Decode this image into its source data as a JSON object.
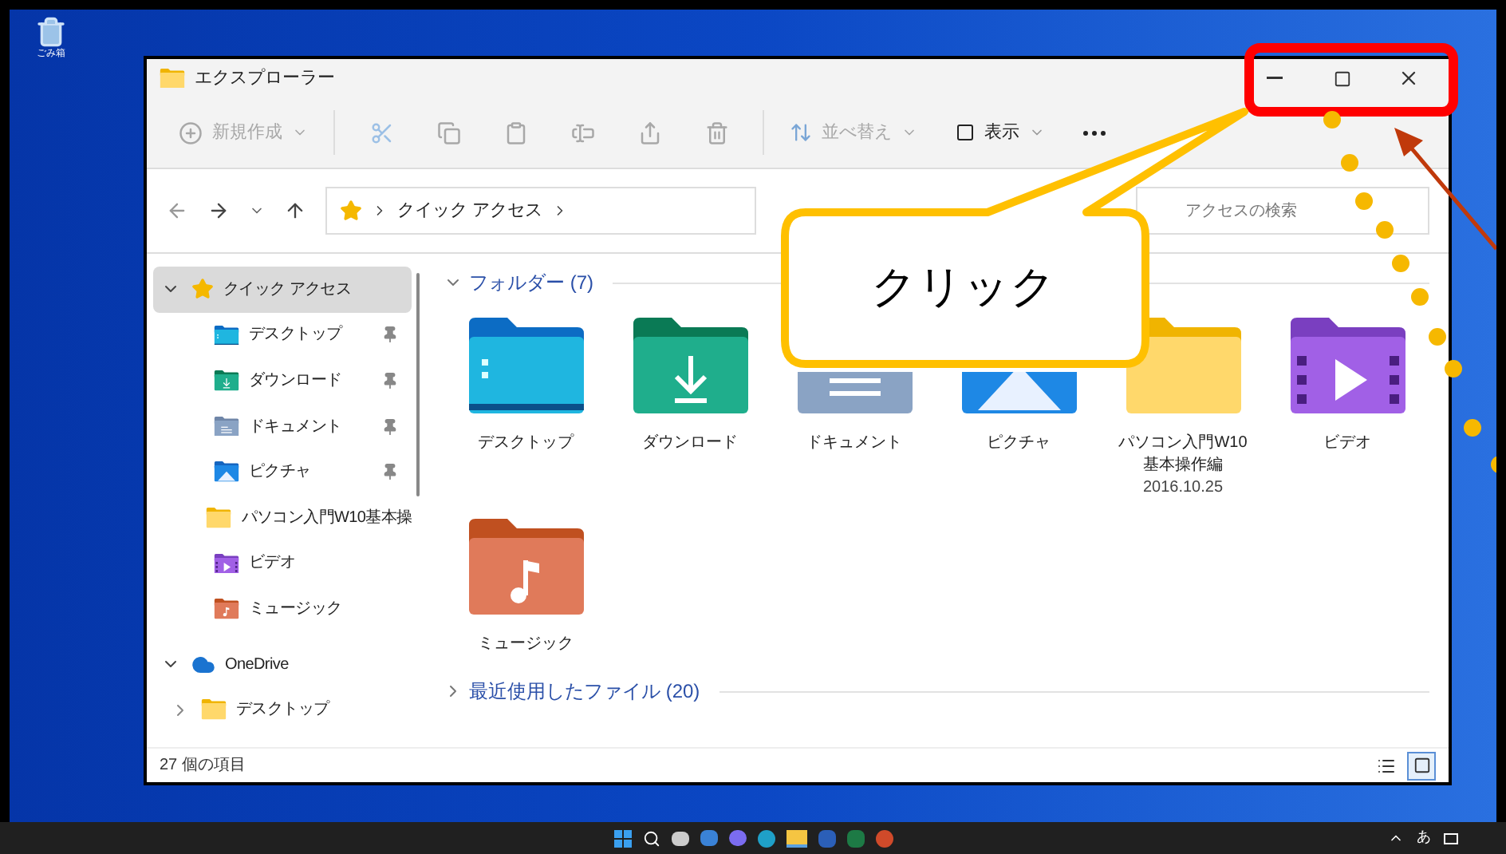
{
  "desktop": {
    "icons": [
      {
        "label": "ごみ箱"
      }
    ]
  },
  "window": {
    "title": "エクスプローラー"
  },
  "toolbar": [
    {
      "kind": "new",
      "label": "新規作成",
      "disabled": true
    },
    {
      "kind": "cut",
      "disabled": true
    },
    {
      "kind": "copy",
      "disabled": true
    },
    {
      "kind": "paste",
      "disabled": true
    },
    {
      "kind": "rename",
      "disabled": true
    },
    {
      "kind": "share",
      "disabled": true
    },
    {
      "kind": "delete",
      "disabled": true
    },
    {
      "kind": "sort",
      "label": "並べ替え",
      "disabled": true
    },
    {
      "kind": "view",
      "label": "表示",
      "disabled": false
    },
    {
      "kind": "more",
      "disabled": false
    }
  ],
  "address_bar": {
    "path": [
      "クイック アクセス"
    ]
  },
  "search": {
    "placeholder": "アクセスの検索"
  },
  "sidebar": {
    "items": [
      {
        "label": "クイック アクセス",
        "kind": "star",
        "expanded": true,
        "selected": true,
        "children": [
          {
            "label": "デスクトップ",
            "kind": "desktop",
            "pinned": true,
            "selected": false
          },
          {
            "label": "ダウンロード",
            "kind": "download",
            "pinned": true,
            "selected": false
          },
          {
            "label": "ドキュメント",
            "kind": "documents",
            "pinned": true,
            "selected": false
          },
          {
            "label": "ピクチャ",
            "kind": "pictures",
            "pinned": true,
            "selected": false
          },
          {
            "label": "パソコン入門W10基本操",
            "kind": "folder",
            "pinned": false,
            "selected": false
          },
          {
            "label": "ビデオ",
            "kind": "video",
            "pinned": false,
            "selected": false
          },
          {
            "label": "ミュージック",
            "kind": "music",
            "pinned": false,
            "selected": false
          }
        ]
      },
      {
        "label": "OneDrive",
        "kind": "cloud",
        "expanded": true,
        "selected": false,
        "children": [
          {
            "label": "デスクトップ",
            "kind": "folder",
            "expanded": false,
            "selected": false
          }
        ]
      }
    ]
  },
  "groups": [
    {
      "label": "フォルダー (7)",
      "expanded": true,
      "items": [
        {
          "name": "デスクトップ",
          "kind": "desktop"
        },
        {
          "name": "ダウンロード",
          "kind": "download"
        },
        {
          "name": "ドキュメント",
          "kind": "documents"
        },
        {
          "name": "ピクチャ",
          "kind": "pictures"
        },
        {
          "name": "パソコン入門W10基本操作編",
          "kind": "folder",
          "date": "2016.10.25"
        },
        {
          "name": "ビデオ",
          "kind": "video"
        },
        {
          "name": "ミュージック",
          "kind": "music"
        }
      ]
    },
    {
      "label": "最近使用したファイル (20)",
      "expanded": false
    }
  ],
  "status_bar": {
    "count": "27 個の項目",
    "views": [
      {
        "kind": "details",
        "selected": false
      },
      {
        "kind": "tiles",
        "selected": true
      }
    ]
  },
  "callout": {
    "text": "クリック"
  },
  "taskbar": {
    "ime": "あ"
  }
}
